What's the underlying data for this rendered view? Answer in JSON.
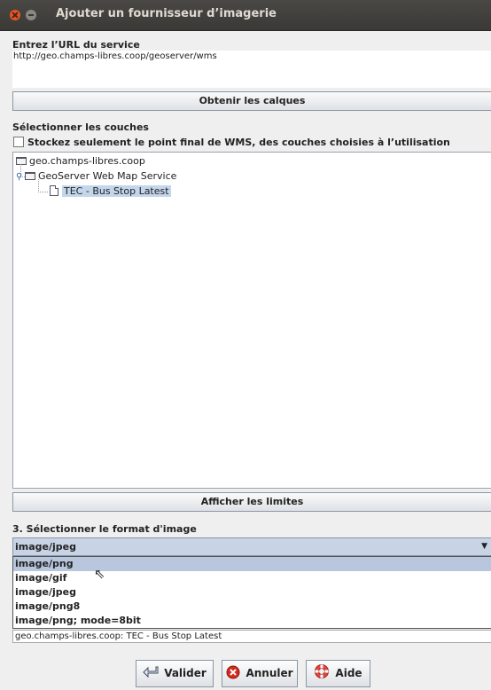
{
  "window": {
    "title": "Ajouter un fournisseur d’imagerie"
  },
  "url_section": {
    "label": "Entrez l’URL du service",
    "value": "http://geo.champs-libres.coop/geoserver/wms",
    "get_layers_button": "Obtenir les calques"
  },
  "layers_section": {
    "label": "Sélectionner les couches",
    "checkbox_label": "Stockez seulement le point final de WMS, des couches choisies à l’utilisation",
    "checkbox_checked": false,
    "tree": {
      "root": "geo.champs-libres.coop",
      "service": "GeoServer Web Map Service",
      "layer": "TEC - Bus Stop Latest"
    },
    "show_bounds_button": "Afficher les limites"
  },
  "format_section": {
    "label": "3. Sélectionner le format d'image",
    "selected": "image/jpeg",
    "options": [
      "image/png",
      "image/gif",
      "image/jpeg",
      "image/png8",
      "image/png; mode=8bit"
    ],
    "hovered_option": "image/png"
  },
  "summary": "geo.champs-libres.coop: TEC - Bus Stop Latest",
  "buttons": {
    "ok": "Valider",
    "cancel": "Annuler",
    "help": "Aide"
  }
}
